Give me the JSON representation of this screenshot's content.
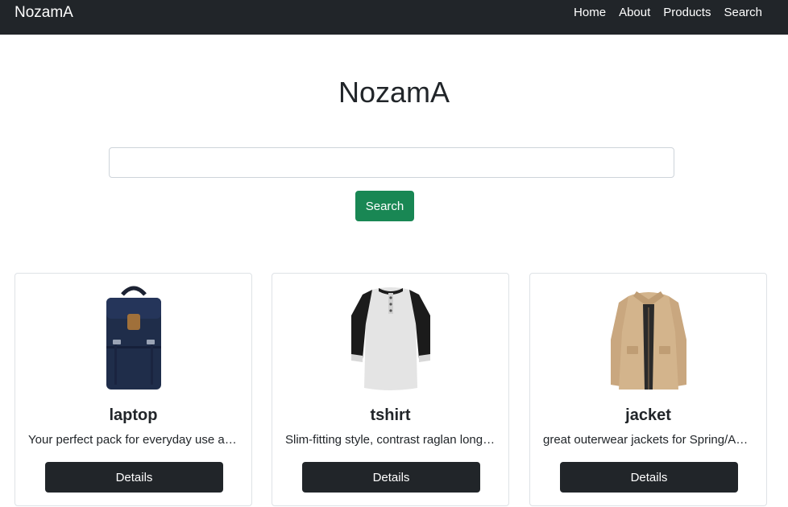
{
  "navbar": {
    "brand": "NozamA",
    "links": [
      "Home",
      "About",
      "Products",
      "Search"
    ]
  },
  "hero": {
    "title": "NozamA"
  },
  "search": {
    "value": "",
    "placeholder": "",
    "button_label": "Search"
  },
  "products": [
    {
      "name": "laptop",
      "description": "Your perfect pack for everyday use and walks in the forest",
      "button_label": "Details",
      "image_icon": "backpack-icon"
    },
    {
      "name": "tshirt",
      "description": "Slim-fitting style, contrast raglan long sleeve",
      "button_label": "Details",
      "image_icon": "tshirt-icon"
    },
    {
      "name": "jacket",
      "description": "great outerwear jackets for Spring/Autumn/Winter",
      "button_label": "Details",
      "image_icon": "jacket-icon"
    }
  ],
  "colors": {
    "navbar_bg": "#212529",
    "search_button": "#198754",
    "details_button": "#212529"
  }
}
